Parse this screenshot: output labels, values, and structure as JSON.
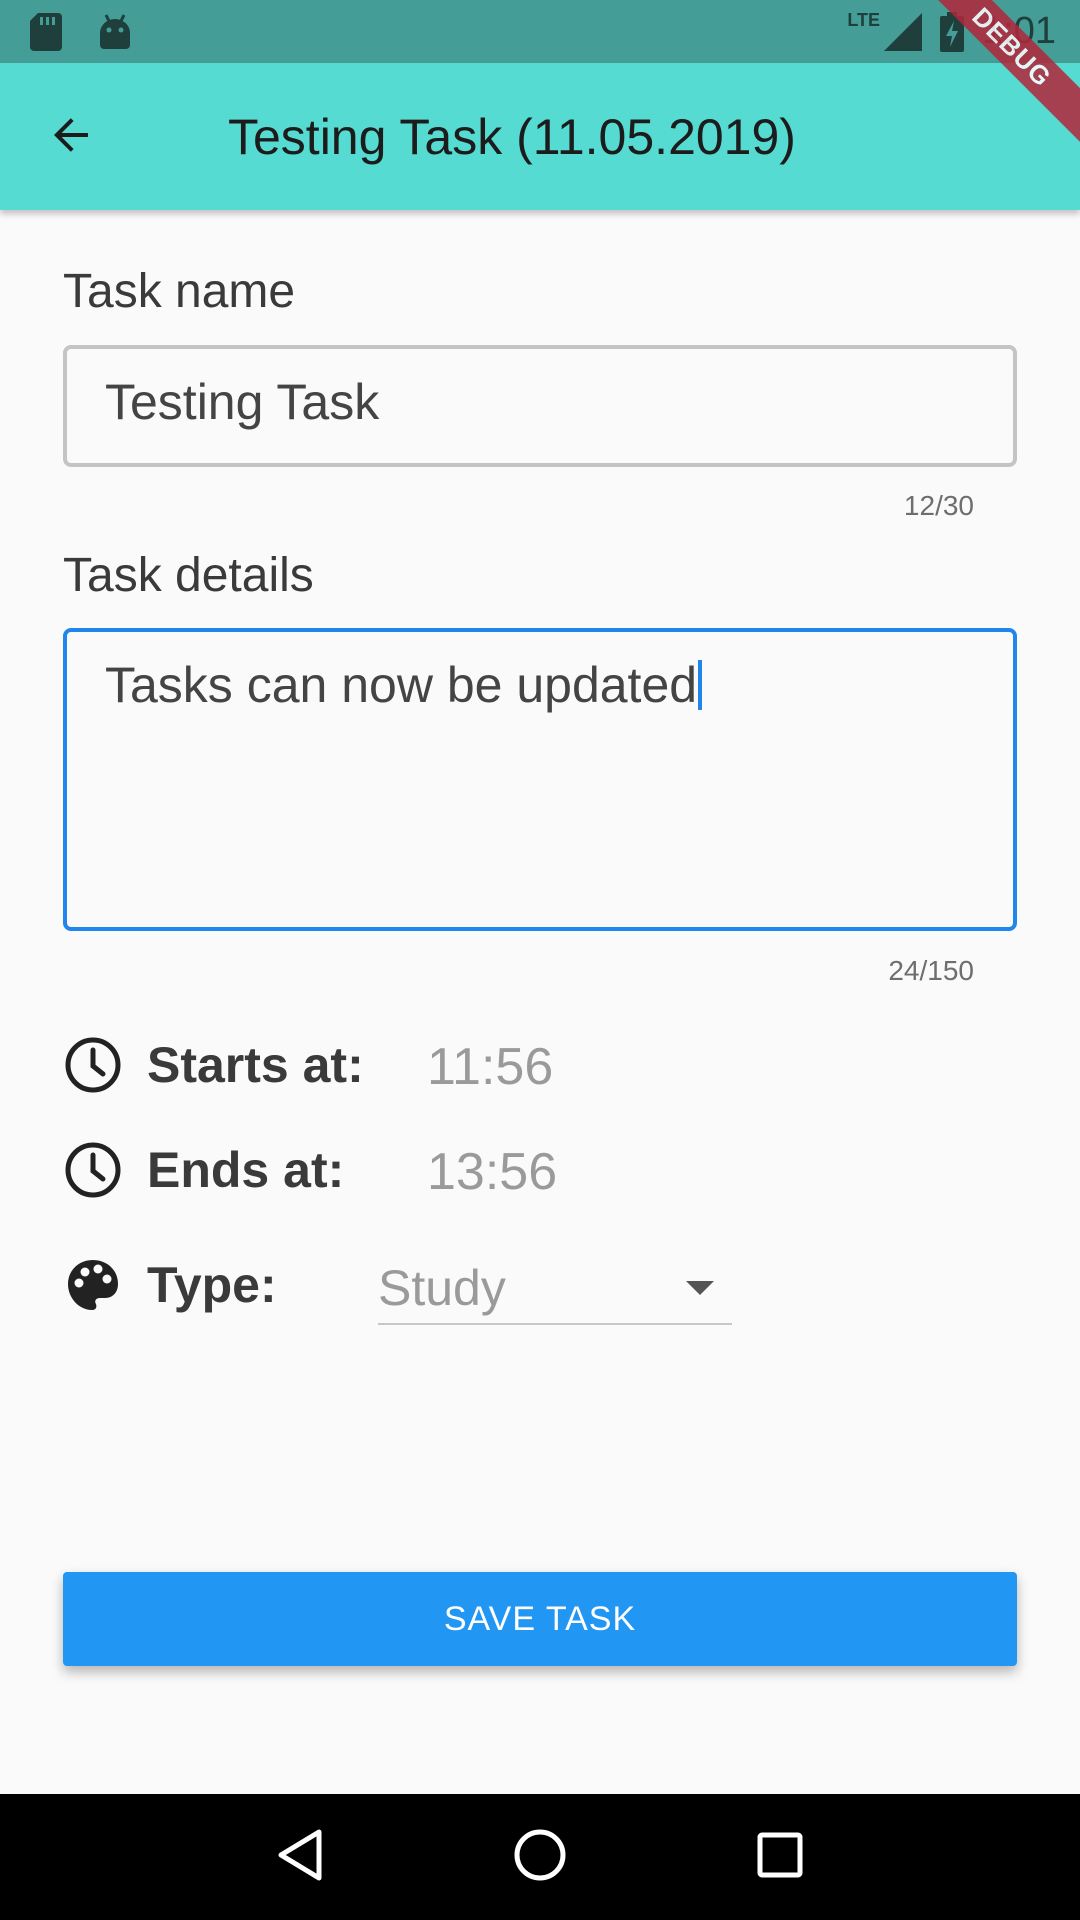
{
  "status_bar": {
    "time": "1:01",
    "network": "LTE",
    "icons": [
      "sd-card-icon",
      "android-icon",
      "signal-icon",
      "battery-charging-icon"
    ]
  },
  "debug_banner": "DEBUG",
  "app_bar": {
    "title": "Testing Task (11.05.2019)",
    "back_icon": "arrow-back-icon"
  },
  "form": {
    "task_name": {
      "label": "Task name",
      "value": "Testing Task",
      "counter": "12/30"
    },
    "task_details": {
      "label": "Task details",
      "value": "Tasks can now be updated",
      "counter": "24/150"
    },
    "starts": {
      "label": "Starts at:",
      "value": "11:56",
      "icon": "clock-icon"
    },
    "ends": {
      "label": "Ends at:",
      "value": "13:56",
      "icon": "clock-icon"
    },
    "type": {
      "label": "Type:",
      "value": "Study",
      "icon": "palette-icon"
    }
  },
  "save_button": {
    "label": "SAVE TASK"
  },
  "colors": {
    "status_bar": "#449e97",
    "app_bar": "#55dbd1",
    "accent": "#2196f3",
    "focus_border": "#2186ec",
    "debug": "#b3263a"
  },
  "nav_bar": {
    "buttons": [
      "back-triangle-icon",
      "home-circle-icon",
      "recents-square-icon"
    ]
  }
}
